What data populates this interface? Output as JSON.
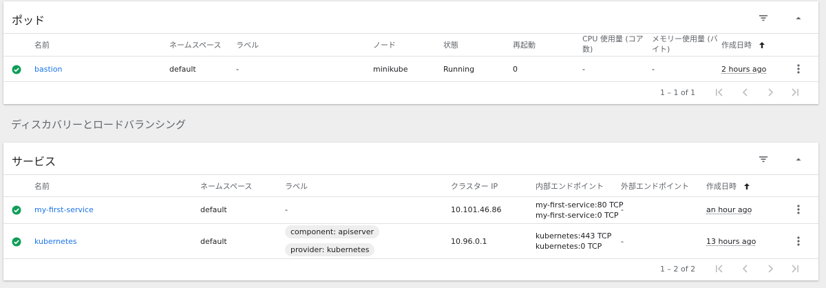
{
  "pods": {
    "title": "ポッド",
    "columns": {
      "name": "名前",
      "namespace": "ネームスペース",
      "labels": "ラベル",
      "node": "ノード",
      "status": "状態",
      "restarts": "再起動",
      "cpu_line1": "CPU 使用量 (コア",
      "cpu_line2": "数)",
      "mem_line1": "メモリー使用量 (バ",
      "mem_line2": "イト)",
      "created": "作成日時"
    },
    "rows": [
      {
        "name": "bastion",
        "namespace": "default",
        "labels": "-",
        "node": "minikube",
        "status": "Running",
        "restarts": "0",
        "cpu": "-",
        "memory": "-",
        "created": "2 hours ago"
      }
    ],
    "pagination": "1 – 1 of 1"
  },
  "discovery_heading": "ディスカバリーとロードバランシング",
  "services": {
    "title": "サービス",
    "columns": {
      "name": "名前",
      "namespace": "ネームスペース",
      "labels": "ラベル",
      "cluster_ip": "クラスター IP",
      "internal_endpoints": "内部エンドポイント",
      "external_endpoints": "外部エンドポイント",
      "created": "作成日時"
    },
    "rows": [
      {
        "name": "my-first-service",
        "namespace": "default",
        "labels": [
          "-"
        ],
        "cluster_ip": "10.101.46.86",
        "internal_endpoints": [
          "my-first-service:80 TCP",
          "my-first-service:0 TCP"
        ],
        "external_endpoints": "-",
        "created": "an hour ago"
      },
      {
        "name": "kubernetes",
        "namespace": "default",
        "labels": [
          "component: apiserver",
          "provider: kubernetes"
        ],
        "cluster_ip": "10.96.0.1",
        "internal_endpoints": [
          "kubernetes:443 TCP",
          "kubernetes:0 TCP"
        ],
        "external_endpoints": "-",
        "created": "13 hours ago"
      }
    ],
    "pagination": "1 – 2 of 2"
  },
  "icons": {
    "filter": "filter-list-icon",
    "collapse": "arrow-drop-up-icon",
    "sort": "arrow-upward-icon",
    "status_ok": "check-circle-icon",
    "row_menu": "more-vert-icon",
    "first_page": "first-page-icon",
    "prev_page": "chevron-left-icon",
    "next_page": "chevron-right-icon",
    "last_page": "last-page-icon"
  },
  "colors": {
    "link": "#1a73e8",
    "status_ok": "#0f9d58",
    "background": "#eeeeee"
  }
}
